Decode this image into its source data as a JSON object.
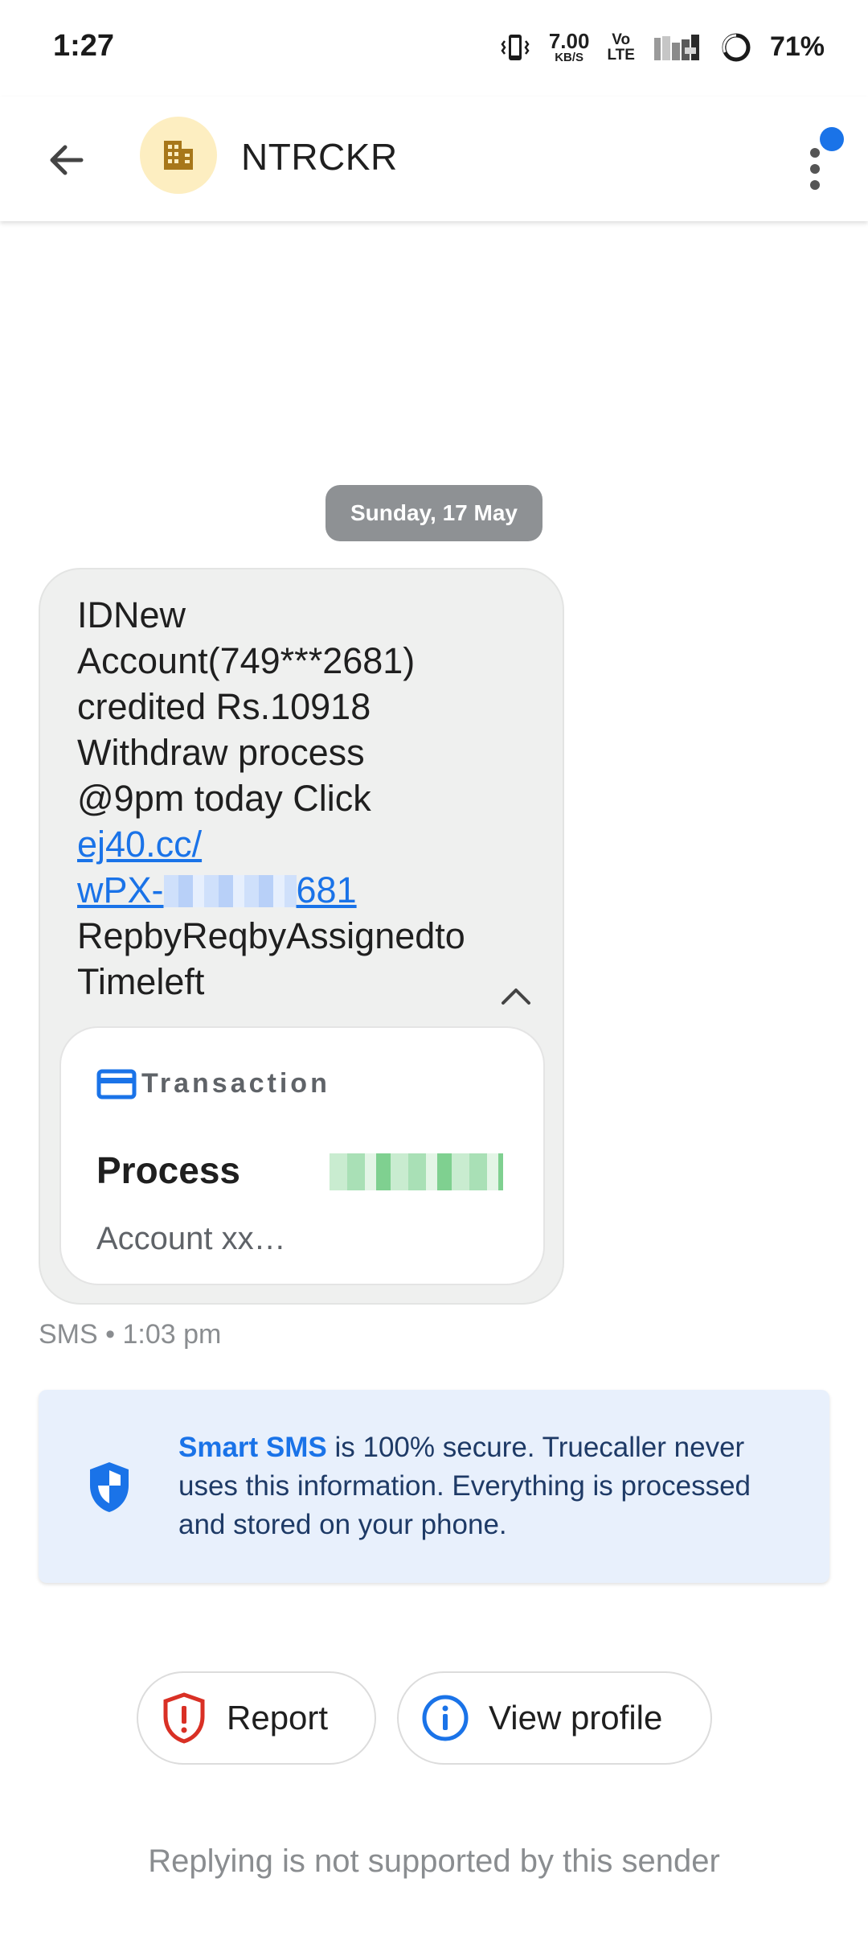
{
  "status_bar": {
    "time": "1:27",
    "speed_value": "7.00",
    "speed_unit": "KB/S",
    "volte_top": "Vo",
    "volte_bottom": "LTE",
    "battery": "71%",
    "icons": [
      "vibrate-icon",
      "signal-icon",
      "battery-icon"
    ]
  },
  "app_bar": {
    "sender": "NTRCKR",
    "avatar_icon": "building-icon",
    "accent": "#1a73e8"
  },
  "conversation": {
    "date": "Sunday, 17 May",
    "message": {
      "lines": [
        "IDNew",
        "Account(749***2681)",
        "credited Rs.10918",
        "Withdraw process",
        "@9pm today Click"
      ],
      "link_line1": "ej40.cc/",
      "link_prefix": "wPX-",
      "link_suffix": "681",
      "trailing_lines": [
        "RepbyReqbyAssignedto",
        "Timeleft"
      ]
    },
    "transaction_card": {
      "label": "Transaction",
      "title": "Process",
      "subtitle": "Account xx…"
    },
    "meta": "SMS • 1:03 pm"
  },
  "info_banner": {
    "highlight": "Smart SMS",
    "text": " is 100% secure. Truecaller never uses this information. Everything is processed and stored on your phone."
  },
  "actions": {
    "report": "Report",
    "view_profile": "View profile"
  },
  "footer": {
    "note": "Replying is not supported by this sender"
  }
}
